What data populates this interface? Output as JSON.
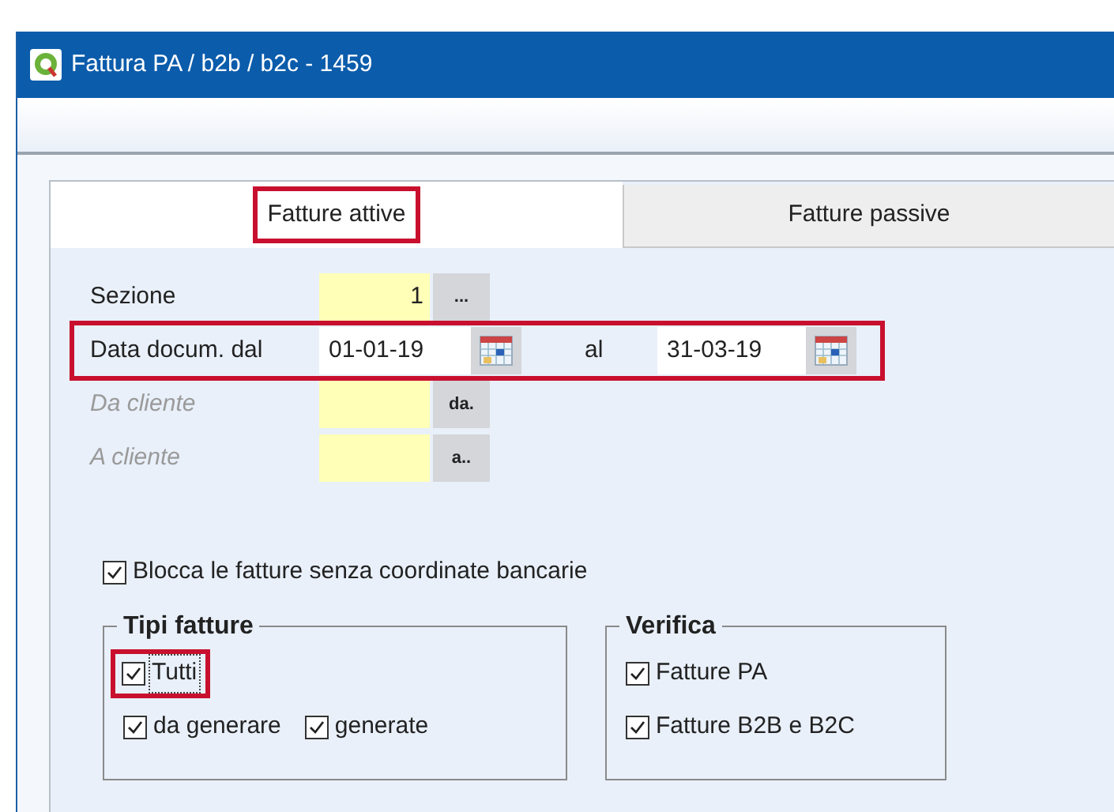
{
  "window": {
    "title": "Fattura PA / b2b / b2c - 1459"
  },
  "tabs": [
    {
      "label": "Fatture attive",
      "selected": true,
      "highlighted": true
    },
    {
      "label": "Fatture passive",
      "selected": false,
      "highlighted": false
    }
  ],
  "fields": [
    {
      "kind": "lookup",
      "label": "Sezione",
      "value": "1",
      "button": "...",
      "disabled": false,
      "highlighted": false
    },
    {
      "kind": "daterange",
      "label": "Data docum. dal",
      "value": "01-01-19",
      "to_label": "al",
      "to_value": "31-03-19",
      "disabled": false,
      "highlighted": true
    },
    {
      "kind": "lookup",
      "label": "Da cliente",
      "button": "da.",
      "disabled": true,
      "highlighted": false
    },
    {
      "kind": "lookup",
      "label": "A cliente",
      "button": "a..",
      "disabled": true,
      "highlighted": false
    }
  ],
  "block_checkbox": {
    "label": "Blocca le fatture senza coordinate bancarie",
    "checked": true
  },
  "groups": [
    {
      "title": "Tipi fatture",
      "rows": [
        [
          {
            "label": "Tutti",
            "checked": true,
            "highlighted": true,
            "focused": true
          }
        ],
        [
          {
            "label": "da generare",
            "checked": true,
            "highlighted": false,
            "focused": false
          },
          {
            "label": "generate",
            "checked": true,
            "highlighted": false,
            "focused": false
          }
        ]
      ]
    },
    {
      "title": "Verifica",
      "rows": [
        [
          {
            "label": "Fatture PA",
            "checked": true,
            "highlighted": false,
            "focused": false
          }
        ],
        [
          {
            "label": "Fatture B2B e B2C",
            "checked": true,
            "highlighted": false,
            "focused": false
          }
        ]
      ]
    }
  ]
}
